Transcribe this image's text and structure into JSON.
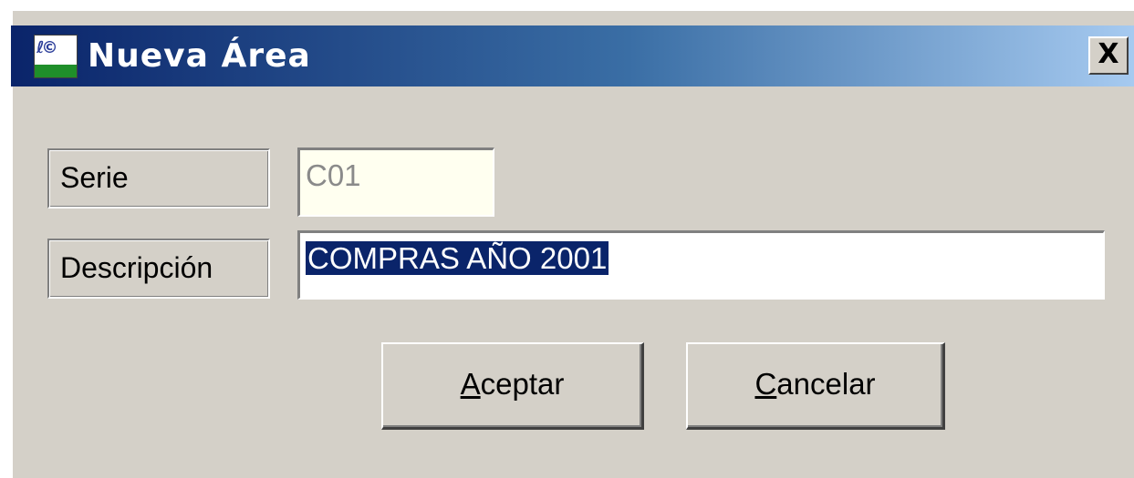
{
  "window": {
    "title": "Nueva Área",
    "close_label": "X"
  },
  "form": {
    "serie_label": "Serie",
    "serie_value": "C01",
    "descripcion_label": "Descripción",
    "descripcion_value": "COMPRAS AÑO 2001"
  },
  "buttons": {
    "accept_accel": "A",
    "accept_rest": "ceptar",
    "cancel_accel": "C",
    "cancel_rest": "ancelar"
  },
  "colors": {
    "titlebar_start": "#0a246a",
    "titlebar_end": "#a6caf0",
    "dialog_bg": "#d4d0c8",
    "selection": "#0a246a",
    "readonly_bg": "#fffff0"
  },
  "icons": {
    "app": "app-icon",
    "close": "close-icon"
  }
}
